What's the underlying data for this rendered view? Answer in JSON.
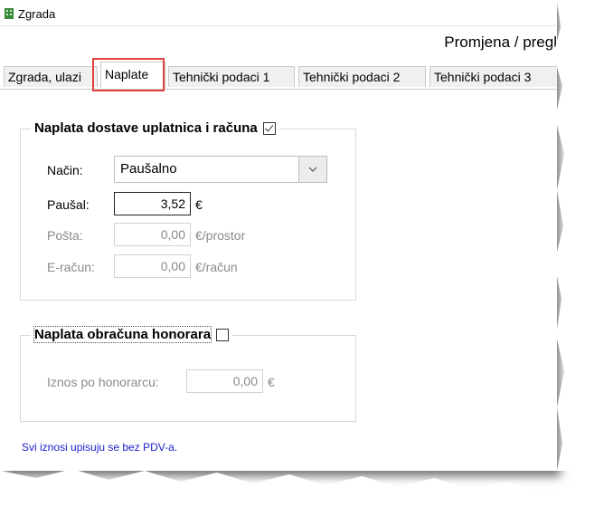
{
  "window": {
    "title": "Zgrada"
  },
  "header": {
    "heading": "Promjena / pregl"
  },
  "tabs": [
    {
      "label": "Zgrada, ulazi"
    },
    {
      "label": "Naplate"
    },
    {
      "label": "Tehnički podaci 1"
    },
    {
      "label": "Tehnički podaci 2"
    },
    {
      "label": "Tehnički podaci 3"
    }
  ],
  "group_dostava": {
    "legend": "Naplata dostave uplatnica i računa",
    "checked": true,
    "nacin_label": "Način:",
    "nacin_value": "Paušalno",
    "pausal_label": "Paušal:",
    "pausal_value": "3,52",
    "pausal_unit": "€",
    "posta_label": "Pošta:",
    "posta_value": "0,00",
    "posta_unit": "€/prostor",
    "eracun_label": "E-račun:",
    "eracun_value": "0,00",
    "eracun_unit": "€/račun"
  },
  "group_honorar": {
    "legend": "Naplata obračuna honorara",
    "checked": false,
    "iznos_label": "Iznos po honorarcu:",
    "iznos_value": "0,00",
    "iznos_unit": "€"
  },
  "footer_note": "Svi iznosi upisuju se bez PDV-a.",
  "colors": {
    "highlight": "#e0413f",
    "note": "#1c1ccc"
  }
}
